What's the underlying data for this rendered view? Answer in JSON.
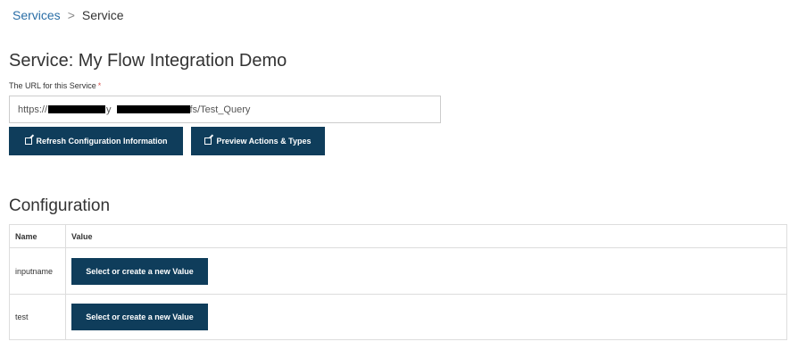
{
  "breadcrumb": {
    "parent_label": "Services",
    "separator": ">",
    "current_label": "Service"
  },
  "page": {
    "title": "Service: My Flow Integration Demo"
  },
  "url_field": {
    "label": "The URL for this Service",
    "required_marker": "*",
    "value_prefix": "https://",
    "value_visible_y": "y",
    "value_suffix": "fs/Test_Query"
  },
  "actions": {
    "refresh_label": "Refresh Configuration Information",
    "preview_label": "Preview Actions & Types"
  },
  "configuration": {
    "section_title": "Configuration",
    "columns": [
      "Name",
      "Value"
    ],
    "rows": [
      {
        "name": "inputname",
        "value_button_label": "Select or create a new Value"
      },
      {
        "name": "test",
        "value_button_label": "Select or create a new Value"
      }
    ]
  },
  "colors": {
    "primary_button": "#0f3d5b",
    "link": "#2a6ea6",
    "required": "#d9534f"
  },
  "icons": {
    "action_button_icon": "edit-icon"
  }
}
